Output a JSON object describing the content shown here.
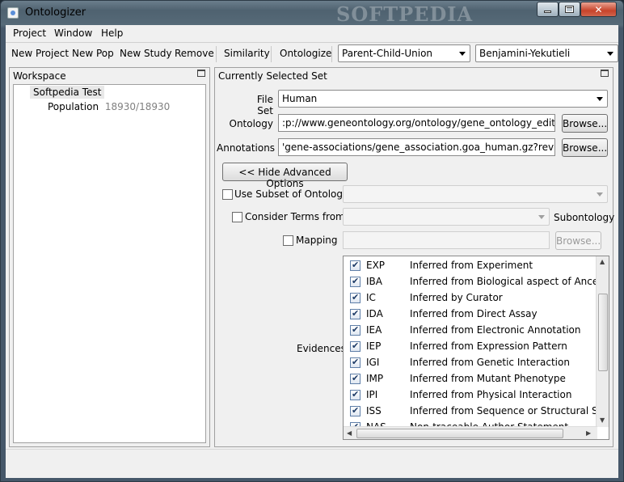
{
  "window": {
    "title": "Ontologizer",
    "watermark": "SOFTPEDIA"
  },
  "menu": [
    "Project",
    "Window",
    "Help"
  ],
  "toolbar": {
    "buttons": [
      "New Project",
      "New Pop",
      "New Study",
      "Remove",
      "Similarity",
      "Ontologize"
    ],
    "method": "Parent-Child-Union",
    "correction": "Benjamini-Yekutieli"
  },
  "workspace": {
    "title": "Workspace",
    "project": "Softpedia Test",
    "population_label": "Population",
    "population_count": "18930/18930"
  },
  "selected_set": {
    "title": "Currently Selected Set",
    "file_set_label": "File Set",
    "file_set_value": "Human",
    "ontology_label": "Ontology",
    "ontology_value": ":p://www.geneontology.org/ontology/gene_ontology_edit.obo",
    "annotations_label": "Annotations",
    "annotations_value": "'gene-associations/gene_association.goa_human.gz?rev=HEAD",
    "browse_label": "Browse...",
    "hide_advanced_label": "<< Hide Advanced Options",
    "use_subset_label": "Use Subset of Ontology",
    "consider_terms_label": "Consider Terms from",
    "subontology_label": "Subontology",
    "mapping_label": "Mapping",
    "evidences_label": "Evidences"
  },
  "evidences": [
    {
      "code": "EXP",
      "desc": "Inferred from Experiment",
      "checked": true
    },
    {
      "code": "IBA",
      "desc": "Inferred from Biological aspect of Ancestor",
      "checked": true
    },
    {
      "code": "IC",
      "desc": "Inferred by Curator",
      "checked": true
    },
    {
      "code": "IDA",
      "desc": "Inferred from Direct Assay",
      "checked": true
    },
    {
      "code": "IEA",
      "desc": "Inferred from Electronic Annotation",
      "checked": true
    },
    {
      "code": "IEP",
      "desc": "Inferred from Expression Pattern",
      "checked": true
    },
    {
      "code": "IGI",
      "desc": "Inferred from Genetic Interaction",
      "checked": true
    },
    {
      "code": "IMP",
      "desc": "Inferred from Mutant Phenotype",
      "checked": true
    },
    {
      "code": "IPI",
      "desc": "Inferred from Physical Interaction",
      "checked": true
    },
    {
      "code": "ISS",
      "desc": "Inferred from Sequence or Structural Similarity",
      "checked": true
    },
    {
      "code": "NAS",
      "desc": "Non-traceable Author Statement",
      "checked": true
    }
  ]
}
